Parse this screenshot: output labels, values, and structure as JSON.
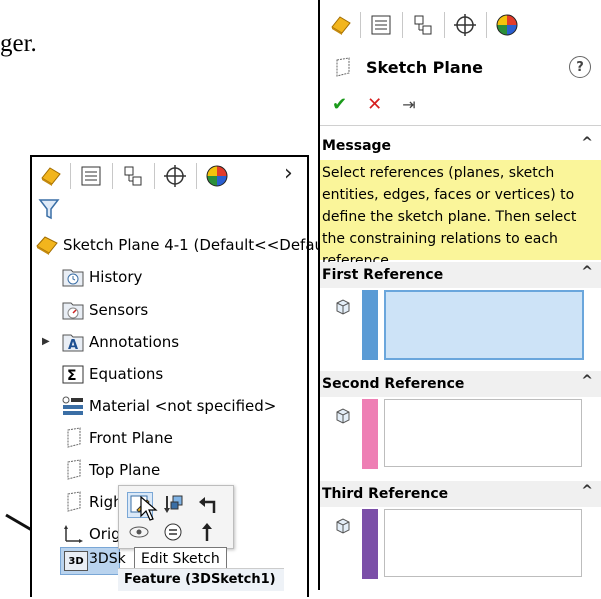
{
  "caption": {
    "text": "ger."
  },
  "feature_manager": {
    "tree": [
      {
        "label": "Sketch Plane 4-1  (Default<<Default:"
      },
      {
        "label": "History"
      },
      {
        "label": "Sensors"
      },
      {
        "label": "Annotations"
      },
      {
        "label": "Equations"
      },
      {
        "label": "Material <not specified>"
      },
      {
        "label": "Front Plane"
      },
      {
        "label": "Top Plane"
      },
      {
        "label": "Righ"
      },
      {
        "label": "Origi"
      },
      {
        "label": "3DSk"
      }
    ],
    "tooltip": "Edit Sketch",
    "feature_label": "Feature (3DSketch1)"
  },
  "property_manager": {
    "title": "Sketch Plane",
    "help": "?",
    "actions": {
      "ok": "✔",
      "cancel": "✕",
      "pin": "⇥"
    },
    "message_header": "Message",
    "message_text": "Select references (planes, sketch entities, edges, faces or vertices) to define the sketch plane. Then select the constraining relations to each reference.",
    "sections": [
      {
        "title": "First Reference",
        "color": "#5b9bd5"
      },
      {
        "title": "Second Reference",
        "color": "#ee7fb4"
      },
      {
        "title": "Third Reference",
        "color": "#7b4fa8"
      }
    ]
  }
}
